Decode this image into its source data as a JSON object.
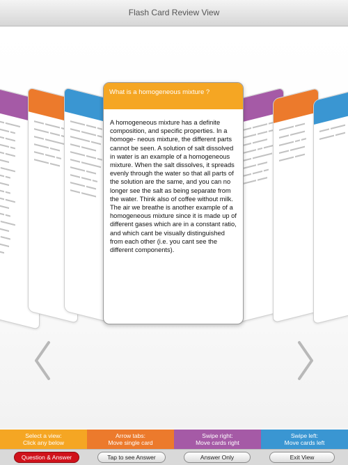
{
  "window": {
    "title": "Flash Card Review View"
  },
  "colors": {
    "orange": "#f5a623",
    "dark_orange": "#ec7a2c",
    "purple": "#a55aa6",
    "blue": "#3a96d2",
    "active_red": "#d0121b"
  },
  "main_card": {
    "question": "What is a homogeneous mixture ?",
    "answer": "A homogeneous mixture has a definite composition, and specific properties. In a homoge- neous mixture, the different parts cannot be seen. A solution of salt dissolved in water is an example of a homogeneous mixture. When the salt dissolves, it spreads evenly through the water so that all parts of the solution are the same, and you can no longer see the salt as being separate from the water. Think also of coffee without milk. The air we breathe is another example of a homogeneous mixture since it is made up of different gases which are in a constant ratio, and which cant be visually distinguished from each other (i.e. you cant see the different components)."
  },
  "nav": {
    "prev_icon": "chevron-left-icon",
    "next_icon": "chevron-right-icon"
  },
  "legend": [
    {
      "line1": "Select a view:",
      "line2": "Click any below"
    },
    {
      "line1": "Arrow tabs:",
      "line2": "Move single card"
    },
    {
      "line1": "Swipe right:",
      "line2": "Move cards right"
    },
    {
      "line1": "Swipe left:",
      "line2": "Move cards left"
    }
  ],
  "buttons": {
    "question_answer": "Question & Answer",
    "tap_answer": "Tap to see Answer",
    "answer_only": "Answer Only",
    "exit_view": "Exit View"
  }
}
